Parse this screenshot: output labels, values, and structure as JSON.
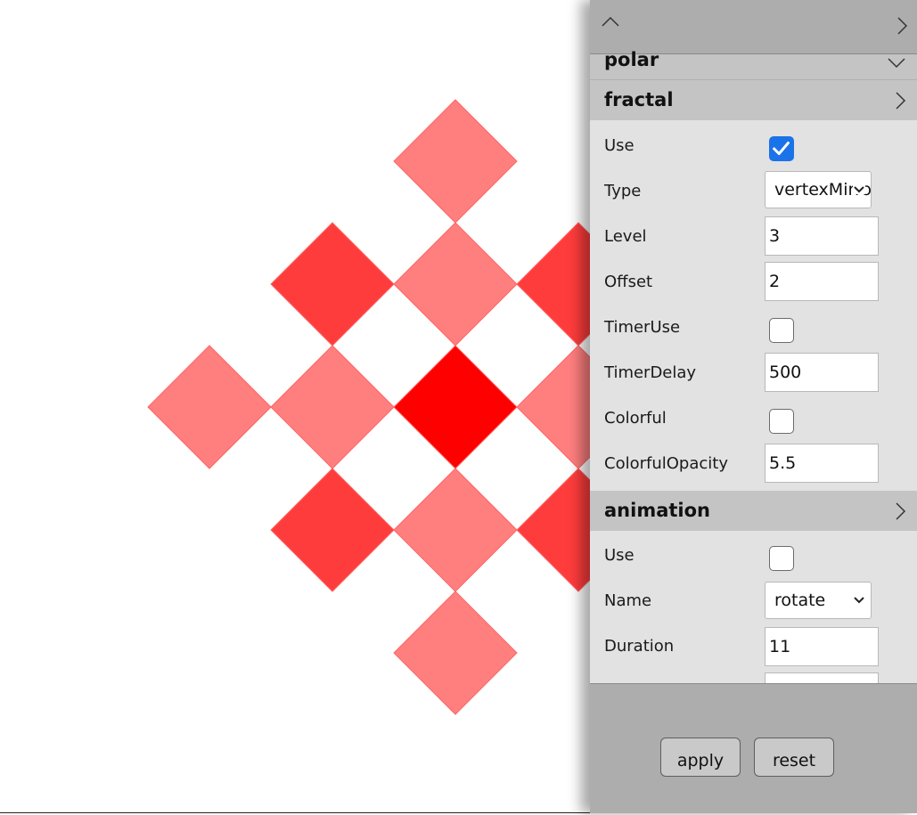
{
  "panel": {
    "sections": {
      "polar": {
        "title": "polar"
      },
      "fractal": {
        "title": "fractal",
        "use_label": "Use",
        "use_checked": true,
        "type_label": "Type",
        "type_value": "vertexMirror",
        "level_label": "Level",
        "level_value": "3",
        "offset_label": "Offset",
        "offset_value": "2",
        "timeruse_label": "TimerUse",
        "timeruse_checked": false,
        "timerdelay_label": "TimerDelay",
        "timerdelay_value": "500",
        "colorful_label": "Colorful",
        "colorful_checked": false,
        "colorfulopacity_label": "ColorfulOpacity",
        "colorfulopacity_value": "5.5"
      },
      "animation": {
        "title": "animation",
        "use_label": "Use",
        "use_checked": false,
        "name_label": "Name",
        "name_value": "rotate",
        "duration_label": "Duration",
        "duration_value": "11"
      }
    },
    "buttons": {
      "apply": "apply",
      "reset": "reset"
    }
  },
  "colors": {
    "light_tile": "#ff7f7f",
    "mid_tile": "#ff3c3c",
    "center_tile": "#ff0000",
    "panel_bg": "#e2e2e2",
    "header_bg": "#c4c4c4",
    "checkbox_checked": "#1a73e8"
  },
  "icons": [
    "chevron-up-icon",
    "chevron-right-icon",
    "chevron-down-icon",
    "checkmark-icon",
    "dropdown-arrow-icon"
  ]
}
